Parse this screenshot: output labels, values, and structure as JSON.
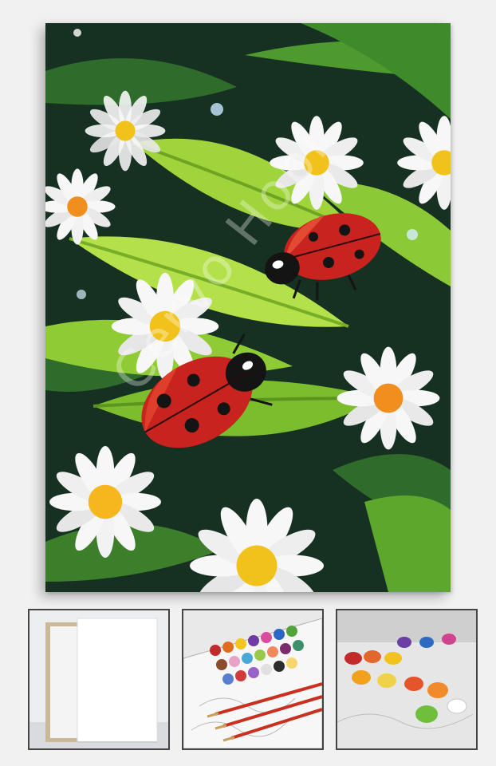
{
  "product": {
    "watermark_text": "Cervo Hobi",
    "main_image": "ladybug-daisy-paint-by-numbers-canvas",
    "thumbnails": [
      {
        "subject": "blank-stretched-canvas"
      },
      {
        "subject": "paint-pots-and-brushes-on-numbered-canvas"
      },
      {
        "subject": "open-paint-pots-close-up"
      }
    ]
  },
  "colors": {
    "background": "#f1f1f1",
    "dark_leaf": "#163022",
    "bright_leaf": "#9fd43a",
    "ladybug_red": "#c8231e",
    "daisy_center": "#f2c21c"
  }
}
